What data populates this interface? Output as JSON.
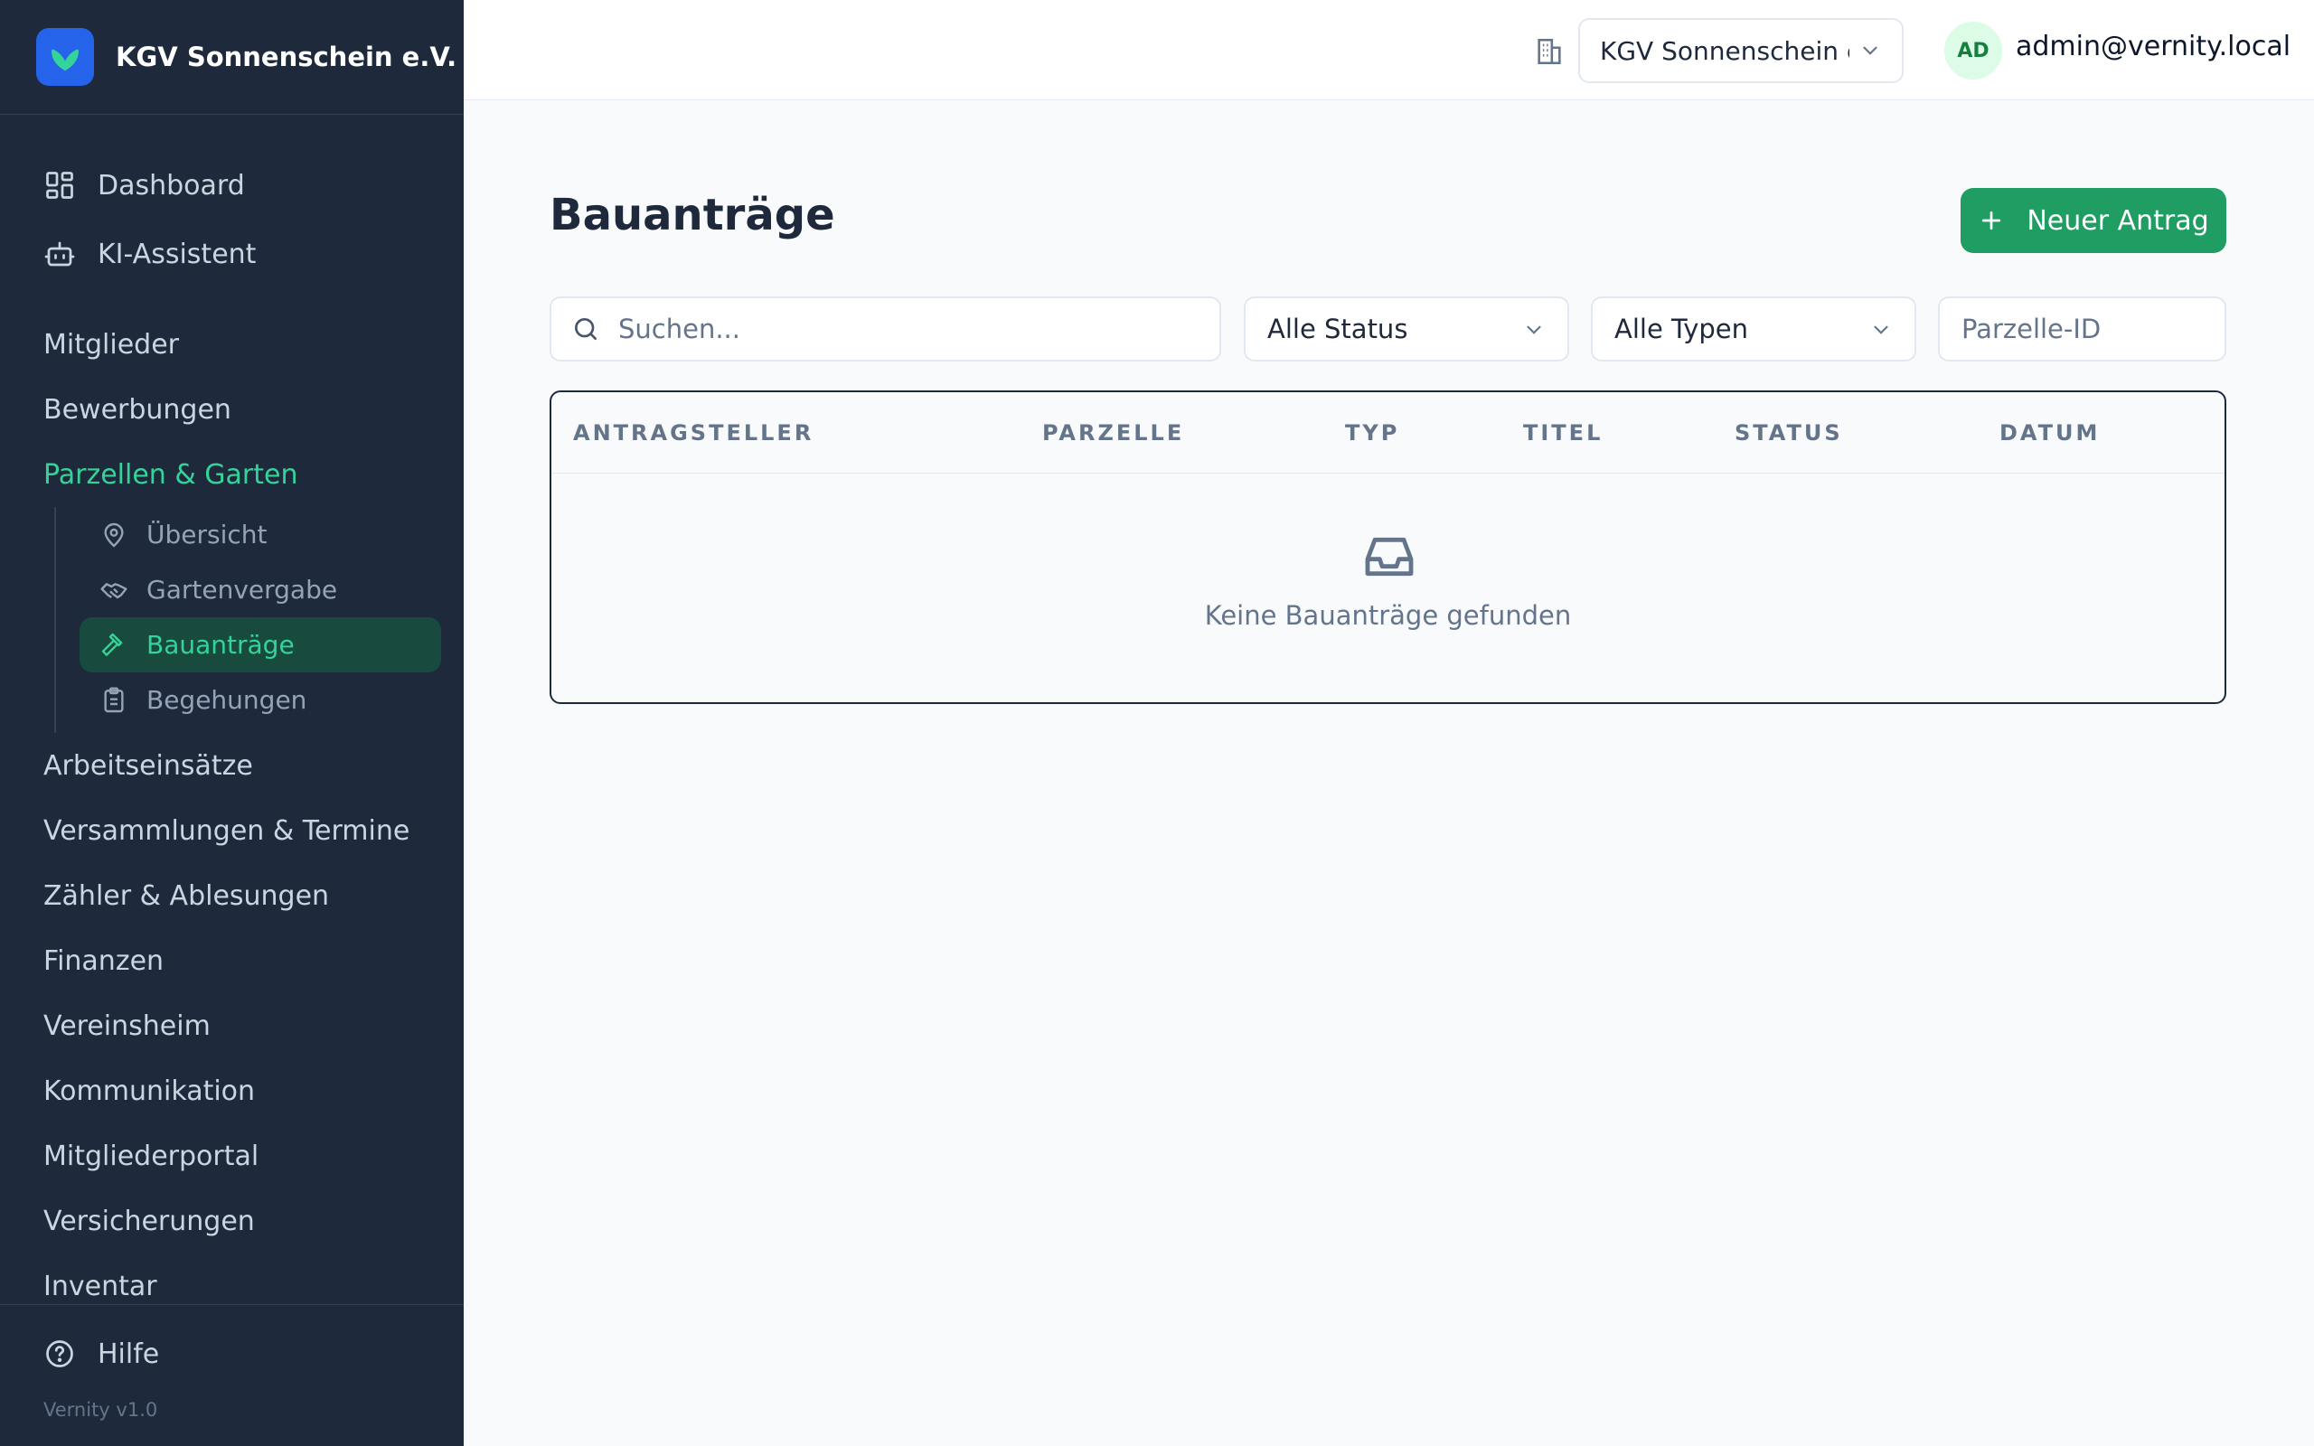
{
  "brand": {
    "name": "KGV Sonnenschein e.V."
  },
  "nav": {
    "top": [
      {
        "label": "Dashboard",
        "icon": "dashboard-icon"
      },
      {
        "label": "KI-Assistent",
        "icon": "robot-icon"
      }
    ],
    "sections": {
      "mitglieder": "Mitglieder",
      "bewerbungen": "Bewerbungen",
      "parzellen": "Parzellen & Garten",
      "arbeitseinsaetze": "Arbeitseinsätze",
      "versammlungen": "Versammlungen & Termine",
      "zaehler": "Zähler & Ablesungen",
      "finanzen": "Finanzen",
      "vereinsheim": "Vereinsheim",
      "kommunikation": "Kommunikation",
      "mitgliederportal": "Mitgliederportal",
      "versicherungen": "Versicherungen",
      "inventar": "Inventar"
    },
    "parzellen_sub": [
      {
        "label": "Übersicht",
        "icon": "map-pin-icon"
      },
      {
        "label": "Gartenvergabe",
        "icon": "handshake-icon"
      },
      {
        "label": "Bauanträge",
        "icon": "hammer-icon",
        "active": true
      },
      {
        "label": "Begehungen",
        "icon": "clipboard-icon"
      }
    ],
    "help": "Hilfe",
    "version": "Vernity v1.0"
  },
  "topbar": {
    "org_select": "KGV Sonnenschein e.V.",
    "avatar_initials": "AD",
    "user_email": "admin@vernity.local"
  },
  "page": {
    "title": "Bauanträge",
    "new_button": "Neuer Antrag",
    "search_placeholder": "Suchen...",
    "status_filter": "Alle Status",
    "type_filter": "Alle Typen",
    "parzelle_placeholder": "Parzelle-ID"
  },
  "table": {
    "columns": [
      "ANTRAGSTELLER",
      "PARZELLE",
      "TYP",
      "TITEL",
      "STATUS",
      "DATUM"
    ],
    "empty_message": "Keine Bauanträge gefunden"
  },
  "colors": {
    "sidebar_bg": "#1e293b",
    "accent_green": "#1f9d63",
    "active_text": "#34d399",
    "brand_blue": "#2563eb"
  }
}
